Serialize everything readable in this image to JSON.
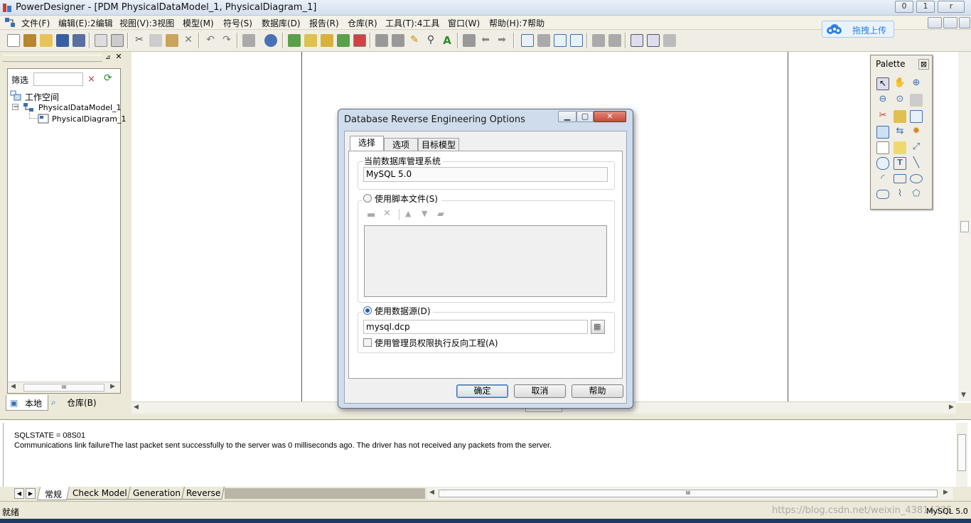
{
  "window": {
    "title": "PowerDesigner - [PDM PhysicalDataModel_1, PhysicalDiagram_1]",
    "min": "0",
    "max": "1",
    "close": "r"
  },
  "menu": [
    "文件(F)",
    "编辑(E):2编辑",
    "视图(V):3视图",
    "模型(M)",
    "符号(S)",
    "数据库(D)",
    "报告(R)",
    "仓库(R)",
    "工具(T):4工具",
    "窗口(W)",
    "帮助(H):7帮助"
  ],
  "upload_button": "拖拽上传",
  "browser": {
    "filter_label": "筛选",
    "tree": [
      "工作空间",
      "PhysicalDataModel_1 *",
      "PhysicalDiagram_1"
    ],
    "tabs": [
      "本地",
      "仓库(B)"
    ],
    "hscroll_thumb": "III"
  },
  "palette": {
    "title": "Palette",
    "close": "⊠"
  },
  "dialog": {
    "title": "Database Reverse Engineering Options",
    "tabs": [
      "选择",
      "选项",
      "目标模型"
    ],
    "dbms_label": "当前数据库管理系统",
    "dbms_value": "MySQL 5.0",
    "script_radio": "使用脚本文件(S)",
    "datasource_radio": "使用数据源(D)",
    "datasource_value": "mysql.dcp",
    "admin_checkbox": "使用管理员权限执行反向工程(A)",
    "buttons": {
      "ok": "确定",
      "cancel": "取消",
      "help": "帮助"
    }
  },
  "output": {
    "lines": [
      "SQLSTATE = 08S01",
      "Communications link failureThe last packet sent successfully to the server was 0 milliseconds ago. The driver has not received any packets from the server."
    ],
    "tabs": [
      "常规",
      "Check Model",
      "Generation",
      "Reverse"
    ],
    "scroll_thumb": "III"
  },
  "status": {
    "left": "就绪",
    "right": "MySQL 5.0",
    "watermark": "https://blog.csdn.net/weixin_43814335"
  },
  "colors": {
    "accent": "#2f7fe0",
    "dialog_frame": "#cfdcec",
    "close_red": "#c9483c"
  }
}
